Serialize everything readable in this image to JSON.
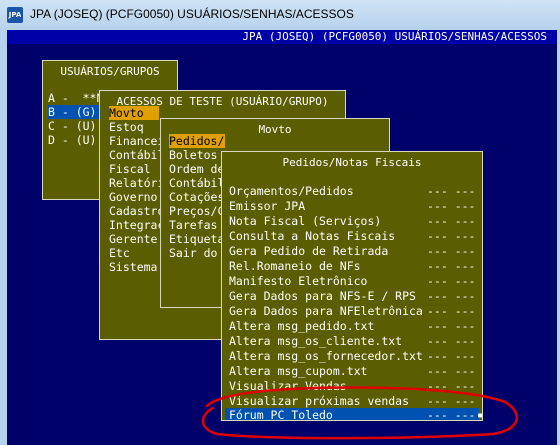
{
  "window": {
    "icon": "JPA",
    "title": "JPA (JOSEQ) (PCFG0050) USUÁRIOS/SENHAS/ACESSOS"
  },
  "console_bar": {
    "title": "JPA (JOSEQ) (PCFG0050) USUÁRIOS/SENHAS/ACESSOS"
  },
  "users_panel": {
    "title": "USUÁRIOS/GRUPOS",
    "items": [
      "A -  **N",
      "B - (G)",
      "C - (U)",
      "D - (U)"
    ]
  },
  "access_panel": {
    "title": "ACESSOS DE TESTE      (USUÁRIO/GRUPO)",
    "items": [
      "Movto",
      "Estoq",
      "Financei",
      "Contábil",
      "Fiscal",
      "Relatóri",
      "Governo",
      "Cadastro",
      "Integraç",
      "Gerente",
      "Etc",
      "Sistema"
    ]
  },
  "movto_panel": {
    "title": "Movto",
    "items": [
      "Pedidos/",
      "Boletos",
      "Ordem de",
      "Contábil",
      "Cotações",
      "Preços/C",
      "Tarefas",
      "Etiqueta",
      "Sair do"
    ]
  },
  "orders_panel": {
    "title": "Pedidos/Notas Fiscais",
    "items": [
      {
        "label": "Orçamentos/Pedidos",
        "value": "--- ---"
      },
      {
        "label": "Emissor JPA",
        "value": "--- ---"
      },
      {
        "label": "Nota Fiscal (Serviços)",
        "value": "--- ---"
      },
      {
        "label": "Consulta a Notas Fiscais",
        "value": "--- ---"
      },
      {
        "label": "Gera Pedido de Retirada",
        "value": "--- ---"
      },
      {
        "label": "Rel.Romaneio de NFs",
        "value": "--- ---"
      },
      {
        "label": "Manifesto Eletrônico",
        "value": "--- ---"
      },
      {
        "label": "Gera Dados para NFS-E / RPS",
        "value": "--- ---"
      },
      {
        "label": "Gera Dados para NFEletrônica",
        "value": "--- ---"
      },
      {
        "label": "Altera msg_pedido.txt",
        "value": "--- ---"
      },
      {
        "label": "Altera msg_os_cliente.txt",
        "value": "--- ---"
      },
      {
        "label": "Altera msg_os_fornecedor.txt",
        "value": "--- ---"
      },
      {
        "label": "Altera msg_cupom.txt",
        "value": "--- ---"
      },
      {
        "label": "Visualizar Vendas",
        "value": "--- ---"
      },
      {
        "label": "Visualizar próximas vendas",
        "value": "--- ---"
      },
      {
        "label": "Fórum PC Toledo",
        "value": "--- ---"
      }
    ]
  },
  "colors": {
    "screen": "#00006b",
    "panel": "#5a5d00",
    "selection": "#0052b0",
    "highlight": "#e0a000",
    "annotation": "#e00000"
  }
}
